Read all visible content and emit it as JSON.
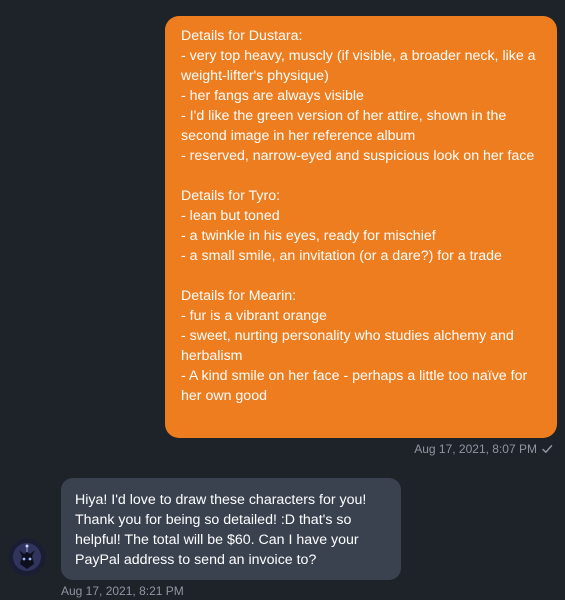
{
  "conversation": {
    "outgoing_message": {
      "text": "Details for Dustara:\n- very top heavy, muscly (if visible, a broader neck, like a weight-lifter's physique)\n- her fangs are always visible\n- I'd like the green version of her attire, shown in the second image in her reference album\n- reserved, narrow-eyed and suspicious look on her face\n\nDetails for Tyro:\n- lean but toned\n- a twinkle in his eyes, ready for mischief\n- a small smile, an invitation (or a dare?) for a trade\n\nDetails for Mearin:\n- fur is a vibrant orange\n- sweet, nurting personality who studies alchemy and herbalism\n- A kind smile on her face - perhaps a little too naïve for her own good",
      "timestamp": "Aug 17, 2021, 8:07 PM",
      "status_icon": "checkmark-icon",
      "bubble_color": "#ee7d1f"
    },
    "incoming_message": {
      "text": "Hiya! I'd love to draw these characters for you! Thank you for being so detailed! :D that's so helpful! The total will be $60. Can I have your PayPal address to send an invoice to?",
      "timestamp": "Aug 17, 2021, 8:21 PM",
      "avatar_icon": "wolf-avatar-icon",
      "bubble_color": "#3a4250"
    }
  }
}
